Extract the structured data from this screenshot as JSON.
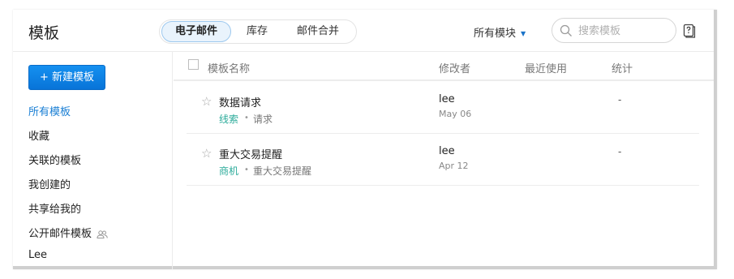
{
  "header": {
    "title": "模板",
    "tabs": [
      {
        "label": "电子邮件",
        "active": true
      },
      {
        "label": "库存",
        "active": false
      },
      {
        "label": "邮件合并",
        "active": false
      }
    ],
    "module_filter": "所有模块",
    "search_placeholder": "搜索模板"
  },
  "sidebar": {
    "new_button": "+ 新建模板",
    "items": [
      {
        "label": "所有模板",
        "active": true
      },
      {
        "label": "收藏"
      },
      {
        "label": "关联的模板"
      },
      {
        "label": "我创建的"
      },
      {
        "label": "共享给我的"
      },
      {
        "label": "公开邮件模板"
      },
      {
        "label": "Lee"
      }
    ]
  },
  "table": {
    "columns": [
      "模板名称",
      "修改者",
      "最近使用",
      "统计"
    ],
    "rows": [
      {
        "star": "☆",
        "name": "数据请求",
        "module": "线索",
        "dot": "•",
        "category": "请求",
        "modified_by": "lee",
        "modified_date": "May 06",
        "last_used": "",
        "stats": "-"
      },
      {
        "star": "☆",
        "name": "重大交易提醒",
        "module": "商机",
        "dot": "•",
        "category": "重大交易提醒",
        "modified_by": "lee",
        "modified_date": "Apr 12",
        "last_used": "",
        "stats": "-"
      }
    ]
  },
  "colors": {
    "accent": "#1a7fd4",
    "button": "#0b7fe0",
    "module_tag": "#2bab9a"
  }
}
